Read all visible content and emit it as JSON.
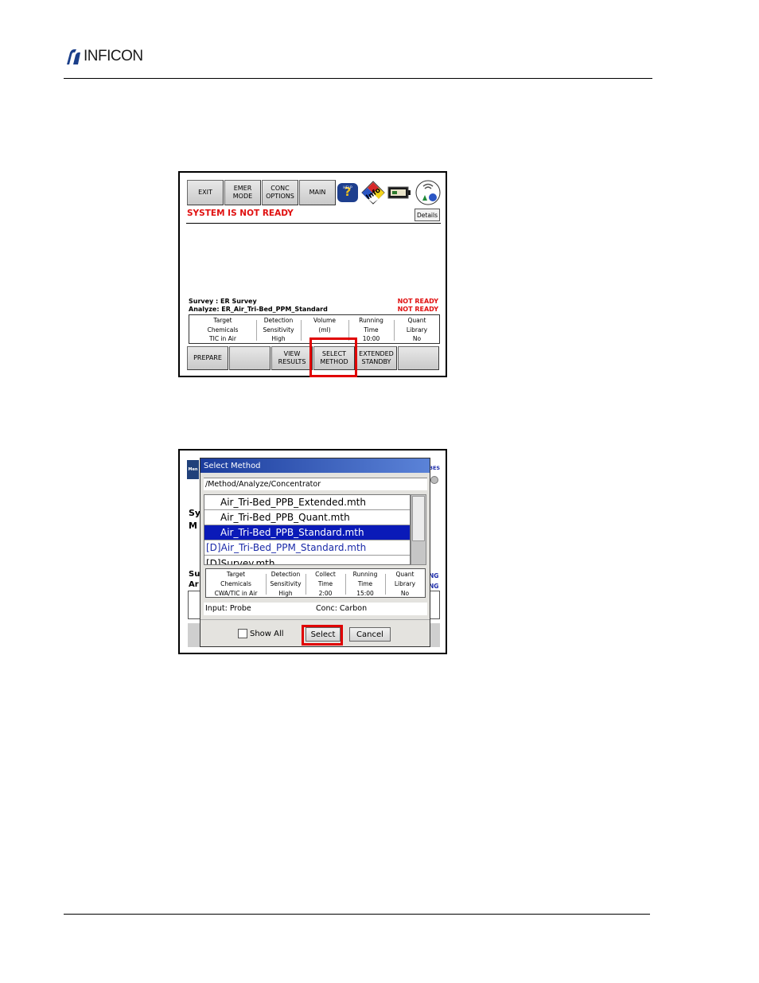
{
  "page_header": {
    "logo_text": "INFICON"
  },
  "screen1": {
    "toolbar": {
      "exit_label": "EXIT",
      "emer_mode_label": "EMER\nMODE",
      "conc_options_label": "CONC\nOPTIONS",
      "main_label": "MAIN",
      "help_icon_text": "HELP",
      "info_icon_text": "Info"
    },
    "status": {
      "text": "SYSTEM IS NOT READY",
      "details_label": "Details"
    },
    "survey_line": "Survey  : ER Survey",
    "analyze_line": "Analyze: ER_Air_Tri-Bed_PPM_Standard",
    "survey_state": "NOT READY",
    "analyze_state": "NOT READY",
    "params": {
      "headers": [
        "Target\nChemicals",
        "Detection\nSensitivity",
        "Volume\n(ml)",
        "Running\nTime",
        "Quant\nLibrary"
      ],
      "values": [
        "TIC in Air",
        "High",
        "",
        "10:00",
        "No"
      ]
    },
    "bottom_buttons": {
      "prepare": "PREPARE",
      "blank1": "",
      "view_results": "VIEW\nRESULTS",
      "select_method": "SELECT\nMETHOD",
      "extended_standby": "EXTENDED\nSTANDBY",
      "blank2": ""
    }
  },
  "screen2": {
    "background_fragments": {
      "men": "Men",
      "sy": "Sy",
      "m": "M",
      "su": "Su",
      "ar": "Ar",
      "bes": "BES",
      "ng1": "NG",
      "ng2": "NG"
    },
    "dialog": {
      "title": "Select Method",
      "path": "/Method/Analyze/Concentrator",
      "files": [
        "Air_Tri-Bed_PPB_Extended.mth",
        "Air_Tri-Bed_PPB_Quant.mth",
        "Air_Tri-Bed_PPB_Standard.mth",
        "[D]Air_Tri-Bed_PPM_Standard.mth",
        "[D]Survey.mth"
      ],
      "selected_file_index": 2,
      "params": {
        "headers": [
          "Target\nChemicals",
          "Detection\nSensitivity",
          "Collect\nTime",
          "Running\nTime",
          "Quant\nLibrary"
        ],
        "values": [
          "CWA/TIC in Air",
          "High",
          "2:00",
          "15:00",
          "No"
        ]
      },
      "input_label": "Input: Probe",
      "conc_label": "Conc: Carbon",
      "show_all_label": "Show All",
      "select_label": "Select",
      "cancel_label": "Cancel"
    }
  },
  "colors": {
    "highlight": "#e00000",
    "status_red": "#e01010",
    "selection_blue": "#0a1ab8",
    "title_blue": "#1b3c9c",
    "default_method_blue": "#1a2aa8"
  }
}
